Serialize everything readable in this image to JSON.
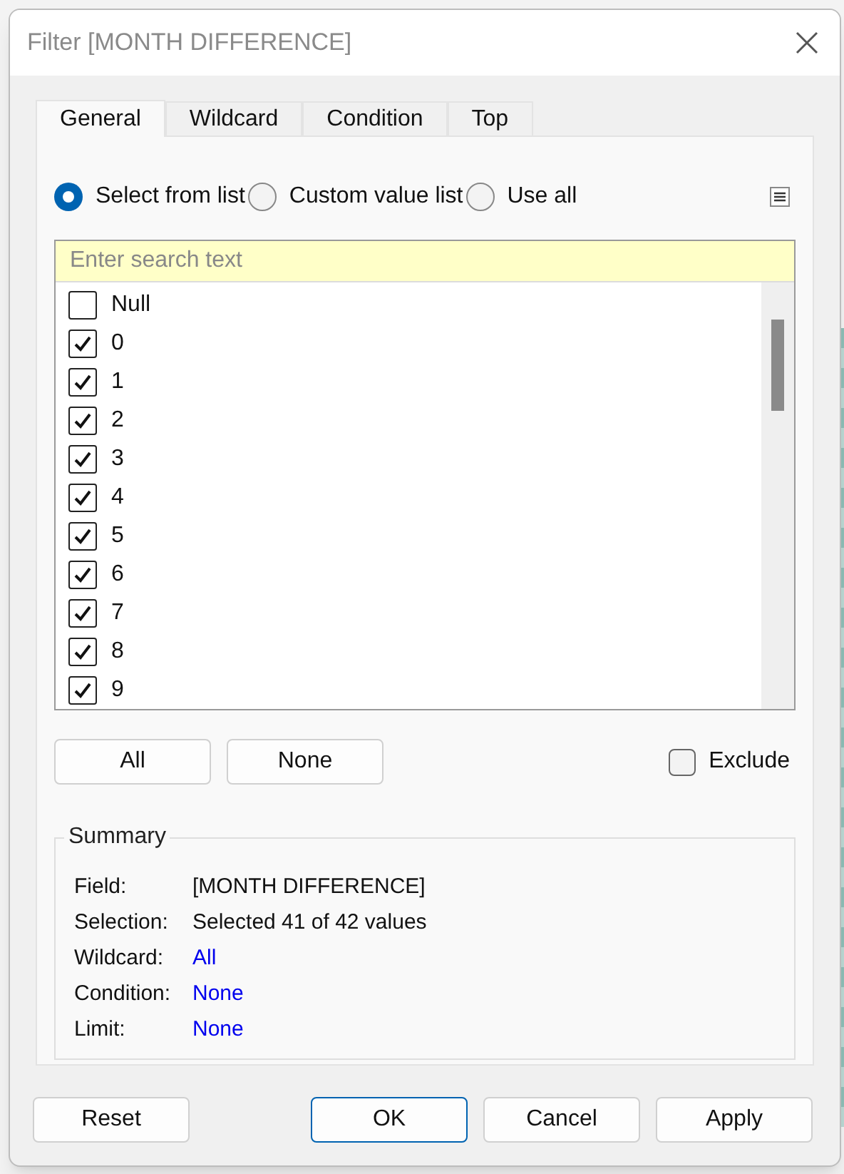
{
  "window": {
    "title": "Filter [MONTH DIFFERENCE]"
  },
  "tabs": [
    {
      "label": "General",
      "selected": true
    },
    {
      "label": "Wildcard",
      "selected": false
    },
    {
      "label": "Condition",
      "selected": false
    },
    {
      "label": "Top",
      "selected": false
    }
  ],
  "mode_options": [
    {
      "label": "Select from list",
      "selected": true
    },
    {
      "label": "Custom value list",
      "selected": false
    },
    {
      "label": "Use all",
      "selected": false
    }
  ],
  "search": {
    "placeholder": "Enter search text"
  },
  "values": [
    {
      "label": "Null",
      "checked": false
    },
    {
      "label": "0",
      "checked": true
    },
    {
      "label": "1",
      "checked": true
    },
    {
      "label": "2",
      "checked": true
    },
    {
      "label": "3",
      "checked": true
    },
    {
      "label": "4",
      "checked": true
    },
    {
      "label": "5",
      "checked": true
    },
    {
      "label": "6",
      "checked": true
    },
    {
      "label": "7",
      "checked": true
    },
    {
      "label": "8",
      "checked": true
    },
    {
      "label": "9",
      "checked": true
    }
  ],
  "list_buttons": [
    "All",
    "None"
  ],
  "exclude": {
    "label": "Exclude",
    "checked": false
  },
  "summary": {
    "title": "Summary",
    "rows": [
      {
        "label": "Field:",
        "value": "[MONTH DIFFERENCE]",
        "link": false
      },
      {
        "label": "Selection:",
        "value": "Selected 41 of 42 values",
        "link": false
      },
      {
        "label": "Wildcard:",
        "value": "All",
        "link": true
      },
      {
        "label": "Condition:",
        "value": "None",
        "link": true
      },
      {
        "label": "Limit:",
        "value": "None",
        "link": true
      }
    ]
  },
  "footer_buttons": [
    {
      "label": "Reset",
      "default": false
    },
    {
      "label": "OK",
      "default": true
    },
    {
      "label": "Cancel",
      "default": false
    },
    {
      "label": "Apply",
      "default": false
    }
  ]
}
